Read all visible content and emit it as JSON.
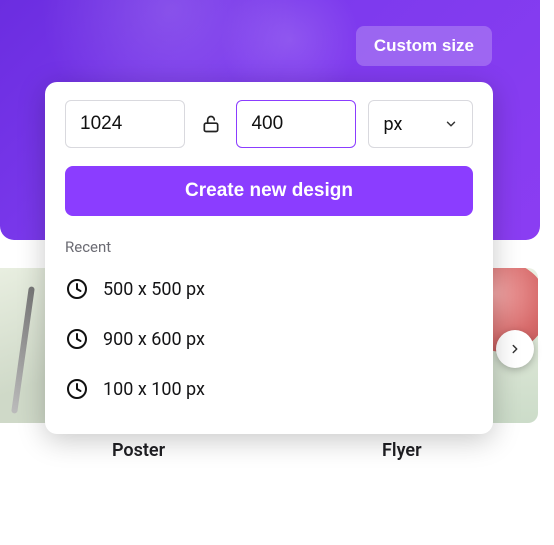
{
  "header": {
    "custom_size_label": "Custom size"
  },
  "panel": {
    "width_value": "1024",
    "height_value": "400",
    "unit_label": "px",
    "create_button_label": "Create new design",
    "recent_heading": "Recent",
    "recent": [
      {
        "label": "500 x 500 px"
      },
      {
        "label": "900 x 600 px"
      },
      {
        "label": "100 x 100 px"
      }
    ]
  },
  "carousel": {
    "items": [
      {
        "label": "Poster"
      },
      {
        "label": "Flyer"
      }
    ]
  },
  "colors": {
    "accent": "#8b3dff",
    "hero_gradient_start": "#6b2de0",
    "hero_gradient_end": "#8b3df2"
  }
}
